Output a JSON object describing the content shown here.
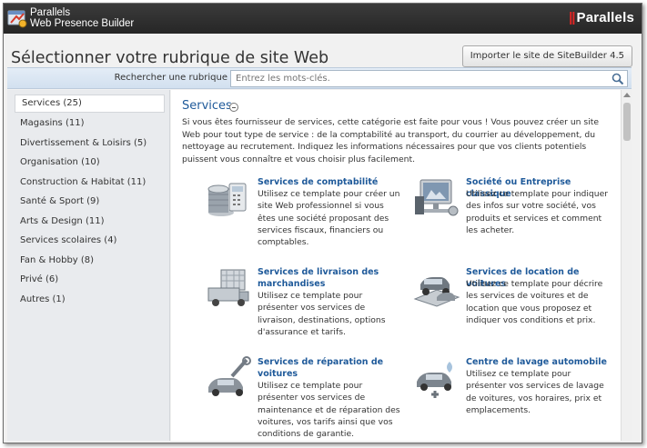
{
  "app": {
    "name_line1": "Parallels",
    "name_line2": "Web Presence Builder",
    "brand": "Parallels",
    "brand_bars": "||"
  },
  "page": {
    "title": "Sélectionner votre rubrique de site Web",
    "import_button": "Importer le site de SiteBuilder 4.5"
  },
  "search": {
    "label": "Rechercher une rubrique",
    "value": "",
    "placeholder": "Entrez les mots-clés."
  },
  "sidebar": {
    "items": [
      {
        "label": "Services (25)",
        "active": true
      },
      {
        "label": "Magasins (11)"
      },
      {
        "label": "Divertissement & Loisirs (5)"
      },
      {
        "label": "Organisation (10)"
      },
      {
        "label": "Construction & Habitat (11)"
      },
      {
        "label": "Santé & Sport (9)"
      },
      {
        "label": "Arts & Design (11)"
      },
      {
        "label": "Services scolaires (4)"
      },
      {
        "label": "Fan & Hobby (8)"
      },
      {
        "label": "Privé (6)"
      },
      {
        "label": "Autres (1)"
      }
    ]
  },
  "section": {
    "title": "Services",
    "description": "Si vous êtes fournisseur de services, cette catégorie est faite pour vous ! Vous pouvez créer un site Web pour tout type de service : de la comptabilité au transport, du courrier au développement, du nettoyage au recrutement. Indiquez les informations nécessaires pour que vos clients potentiels puissent vous connaître et vous choisir plus facilement."
  },
  "templates": [
    {
      "title": "Services de comptabilité",
      "desc": "Utilisez ce template pour créer un site Web professionnel si vous êtes une société proposant des services fiscaux, financiers ou comptables.",
      "icon": "coins-calculator-icon"
    },
    {
      "title": "Société ou Entreprise classique",
      "desc": "Utilisez ce template pour indiquer des infos sur votre société, vos produits et services et comment les acheter.",
      "icon": "office-building-icon"
    },
    {
      "title": "Services de livraison des marchandises",
      "desc": "Utilisez ce template pour présenter vos services de livraison, destinations, options d'assurance et tarifs.",
      "icon": "delivery-truck-icon"
    },
    {
      "title": "Services de location de voitures",
      "desc": "Utilisez ce template pour décrire les services de voitures et de location que vous proposez et indiquer vos conditions et prix.",
      "icon": "car-rental-icon"
    },
    {
      "title": "Services de réparation de voitures",
      "desc": "Utilisez ce template pour présenter vos services de maintenance et de réparation des voitures, vos tarifs ainsi que vos conditions de garantie.",
      "icon": "car-repair-icon"
    },
    {
      "title": "Centre de lavage automobile",
      "desc": "Utilisez ce template pour présenter vos services de lavage de voitures, vos horaires, prix et emplacements.",
      "icon": "car-wash-icon"
    }
  ]
}
